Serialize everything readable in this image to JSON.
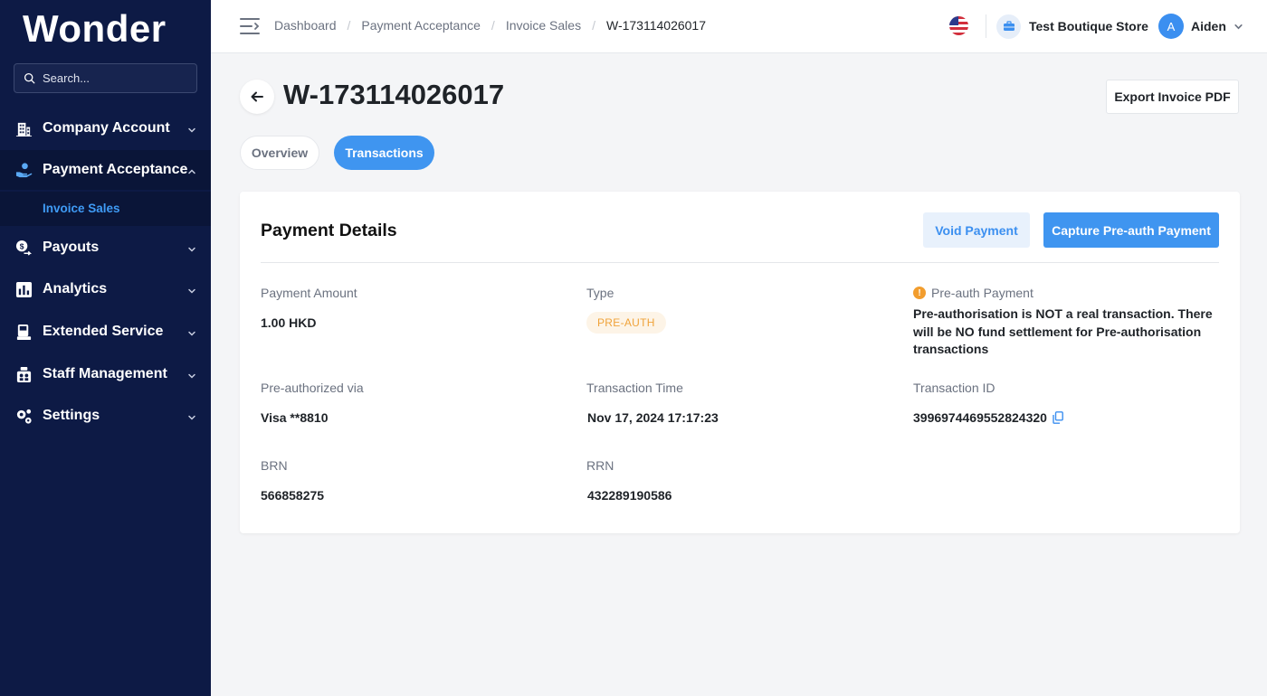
{
  "sidebar": {
    "brand": "Wonder",
    "search_placeholder": "Search...",
    "items": [
      {
        "label": "Company Account",
        "icon": "building-icon"
      },
      {
        "label": "Payment Acceptance",
        "icon": "hand-payment-icon"
      },
      {
        "label": "Payouts",
        "icon": "payouts-icon"
      },
      {
        "label": "Analytics",
        "icon": "bar-chart-icon"
      },
      {
        "label": "Extended Service",
        "icon": "pos-terminal-icon"
      },
      {
        "label": "Staff Management",
        "icon": "staff-icon"
      },
      {
        "label": "Settings",
        "icon": "gears-icon"
      }
    ],
    "sub_item": "Invoice Sales"
  },
  "header": {
    "breadcrumb": [
      "Dashboard",
      "Payment Acceptance",
      "Invoice Sales",
      "W-173114026017"
    ],
    "store": "Test Boutique Store",
    "user_initial": "A",
    "user_name": "Aiden"
  },
  "page": {
    "title": "W-173114026017",
    "export_label": "Export Invoice PDF",
    "tabs": [
      "Overview",
      "Transactions"
    ],
    "active_tab": "Transactions"
  },
  "card": {
    "title": "Payment Details",
    "void_label": "Void Payment",
    "capture_label": "Capture Pre-auth Payment",
    "fields": {
      "amount_label": "Payment Amount",
      "amount": "1.00 HKD",
      "type_label": "Type",
      "type_badge": "PRE-AUTH",
      "notice_title": "Pre-auth Payment",
      "notice_body": "Pre-authorisation is NOT a real transaction. There will be NO fund settlement for Pre-authorisation transactions",
      "via_label": "Pre-authorized via",
      "via": "Visa **8810",
      "time_label": "Transaction Time",
      "time": "Nov 17, 2024 17:17:23",
      "txid_label": "Transaction ID",
      "txid": "3996974469552824320",
      "brn_label": "BRN",
      "brn": "566858275",
      "rrn_label": "RRN",
      "rrn": "432289190586"
    }
  },
  "colors": {
    "sidebar_bg": "#0d1a45",
    "accent": "#3f95f0",
    "badge_text": "#f0a33a",
    "badge_bg": "#fdf4e7"
  }
}
